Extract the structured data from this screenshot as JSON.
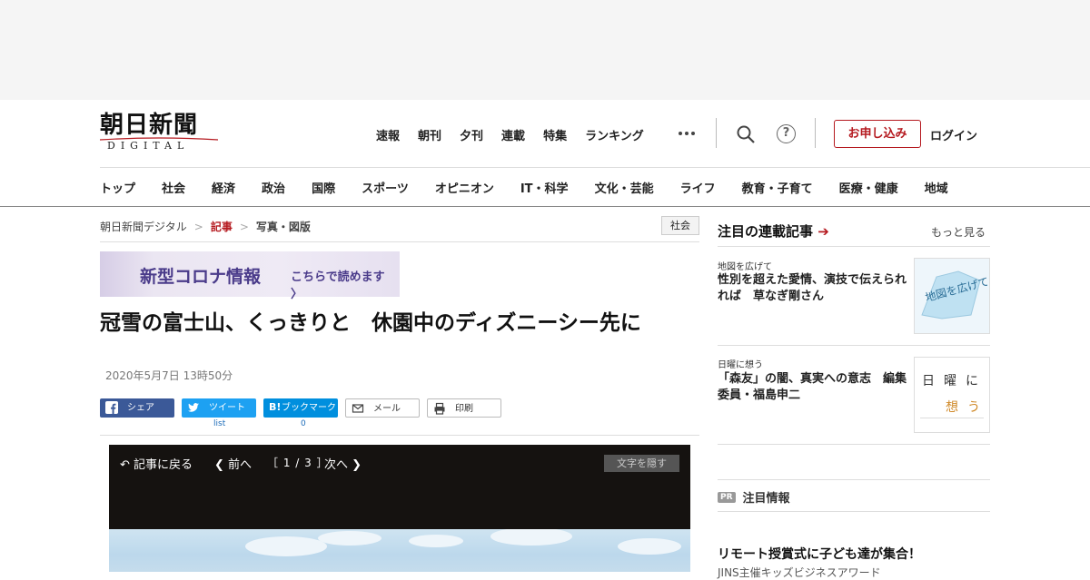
{
  "header": {
    "logo_kanji": "朝日新聞",
    "logo_sub": "DIGITAL",
    "top_nav": [
      "速報",
      "朝刊",
      "夕刊",
      "連載",
      "特集",
      "ランキング"
    ],
    "subscribe_label": "お申し込み",
    "login_label": "ログイン",
    "help_label": "?"
  },
  "category_nav": [
    "トップ",
    "社会",
    "経済",
    "政治",
    "国際",
    "スポーツ",
    "オピニオン",
    "IT・科学",
    "文化・芸能",
    "ライフ",
    "教育・子育て",
    "医療・健康",
    "地域"
  ],
  "breadcrumb": {
    "home": "朝日新聞デジタル",
    "article": "記事",
    "current": "写真・図版",
    "tag": "社会"
  },
  "banner": {
    "title": "新型コロナ情報",
    "link": "こちらで読めます"
  },
  "article": {
    "title": "冠雪の富士山、くっきりと　休園中のディズニーシー先に",
    "date": "2020年5月7日 13時50分"
  },
  "share": {
    "facebook": "シェア",
    "twitter": "ツイート",
    "twitter_count": "list",
    "hatena": "ブックマーク",
    "hatena_count": "0",
    "mail": "メール",
    "print": "印刷"
  },
  "viewer": {
    "back": "記事に戻る",
    "prev": "前へ",
    "pager": "［ 1 / 3 ］",
    "next": "次へ",
    "hide_text": "文字を隠す"
  },
  "sidebar": {
    "heading": "注目の連載記事",
    "more": "もっと見る",
    "items": [
      {
        "category": "地図を広げて",
        "title": "性別を超えた愛情、演技で伝えられれば　草なぎ剛さん",
        "thumb_text": "地図を広げて"
      },
      {
        "category": "日曜に想う",
        "title": "「森友」の闇、真実への意志　編集委員・福島申二",
        "thumb_text_1": "日",
        "thumb_text_2": "曜",
        "thumb_text_3": "に",
        "thumb_text_4": "想",
        "thumb_text_5": "う"
      }
    ],
    "pr_badge": "PR",
    "pr_heading": "注目情報",
    "promo_title": "リモート授賞式に子ども達が集合！",
    "promo_sub": "JINS主催キッズビジネスアワード"
  },
  "colors": {
    "brand_red": "#b5191f",
    "facebook": "#3b5998",
    "twitter": "#1da1f2",
    "hatena": "#008fde",
    "banner_text": "#4a3b8a"
  }
}
